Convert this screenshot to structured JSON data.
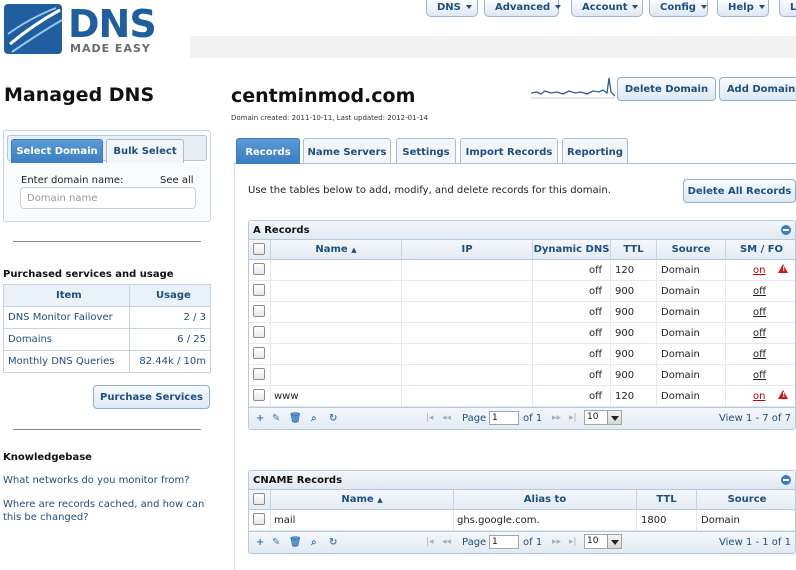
{
  "logo": {
    "word": "DNS",
    "sub": "MADE EASY"
  },
  "nav": {
    "items": [
      {
        "label": "DNS"
      },
      {
        "label": "Advanced"
      },
      {
        "label": "Account"
      },
      {
        "label": "Config"
      },
      {
        "label": "Help"
      },
      {
        "label": "Lo"
      }
    ]
  },
  "sidebar": {
    "title": "Managed DNS",
    "tabs": [
      "Select Domain",
      "Bulk Select"
    ],
    "enter_label": "Enter domain name:",
    "see_all": "See all",
    "domain_placeholder": "Domain name",
    "purchased_title": "Purchased services and usage",
    "usage_headers": [
      "Item",
      "Usage"
    ],
    "usage_rows": [
      {
        "item": "DNS Monitor Failover",
        "usage": "2 / 3"
      },
      {
        "item": "Domains",
        "usage": "6 / 25"
      },
      {
        "item": "Monthly DNS Queries",
        "usage": "82.44k / 10m"
      }
    ],
    "purchase_button": "Purchase Services",
    "kb_title": "Knowledgebase",
    "kb_links": [
      "What networks do you monitor from?",
      "Where are records cached, and how can this be changed?"
    ]
  },
  "main": {
    "domain": "centminmod.com",
    "meta": "Domain created: 2011-10-11, Last updated: 2012-01-14",
    "delete_domain": "Delete Domain",
    "add_domains": "Add Domains",
    "tabs": [
      "Records",
      "Name Servers",
      "Settings",
      "Import Records",
      "Reporting"
    ],
    "intro": "Use the tables below to add, modify, and delete records for this domain.",
    "delete_all": "Delete All Records",
    "a_records": {
      "caption": "A Records",
      "headers": [
        "Name",
        "IP",
        "Dynamic DNS",
        "TTL",
        "Source",
        "SM / FO"
      ],
      "rows": [
        {
          "name": "",
          "ip": "",
          "dyn": "off",
          "ttl": "120",
          "source": "Domain",
          "smfo": "on",
          "warn": true
        },
        {
          "name": "",
          "ip": "",
          "dyn": "off",
          "ttl": "900",
          "source": "Domain",
          "smfo": "off",
          "warn": false
        },
        {
          "name": "",
          "ip": "",
          "dyn": "off",
          "ttl": "900",
          "source": "Domain",
          "smfo": "off",
          "warn": false
        },
        {
          "name": "",
          "ip": "",
          "dyn": "off",
          "ttl": "900",
          "source": "Domain",
          "smfo": "off",
          "warn": false
        },
        {
          "name": "",
          "ip": "",
          "dyn": "off",
          "ttl": "900",
          "source": "Domain",
          "smfo": "off",
          "warn": false
        },
        {
          "name": "",
          "ip": "",
          "dyn": "off",
          "ttl": "900",
          "source": "Domain",
          "smfo": "off",
          "warn": false
        },
        {
          "name": "www",
          "ip": "",
          "dyn": "off",
          "ttl": "120",
          "source": "Domain",
          "smfo": "on",
          "warn": true
        }
      ],
      "pager": {
        "page_label": "Page",
        "page": "1",
        "of": "of 1",
        "per_page": "10",
        "view": "View 1 - 7 of 7"
      }
    },
    "cname_records": {
      "caption": "CNAME Records",
      "headers": [
        "Name",
        "Alias to",
        "TTL",
        "Source"
      ],
      "rows": [
        {
          "name": "mail",
          "alias": "ghs.google.com.",
          "ttl": "1800",
          "source": "Domain"
        }
      ],
      "pager": {
        "page_label": "Page",
        "page": "1",
        "of": "of 1",
        "per_page": "10",
        "view": "View 1 - 1 of 1"
      }
    }
  }
}
